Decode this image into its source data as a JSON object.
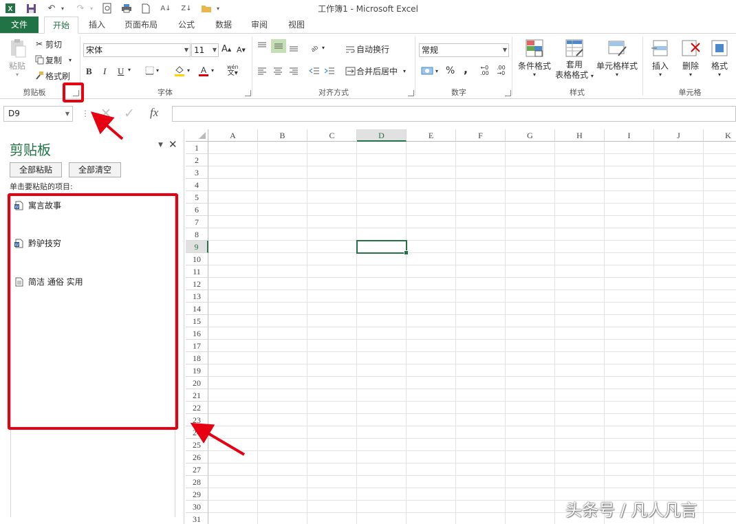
{
  "window": {
    "title": "工作簿1 - Microsoft Excel"
  },
  "tabs": [
    {
      "label": "文件"
    },
    {
      "label": "开始"
    },
    {
      "label": "插入"
    },
    {
      "label": "页面布局"
    },
    {
      "label": "公式"
    },
    {
      "label": "数据"
    },
    {
      "label": "审阅"
    },
    {
      "label": "视图"
    }
  ],
  "ribbon": {
    "clipboard": {
      "paste": "粘贴",
      "cut": "剪切",
      "copy": "复制",
      "format_painter": "格式刷",
      "group": "剪贴板"
    },
    "font": {
      "name": "宋体",
      "size": "11",
      "bold": "B",
      "italic": "I",
      "underline": "U",
      "phonetic": "wén",
      "group": "字体"
    },
    "alignment": {
      "wrap": "自动换行",
      "merge": "合并后居中",
      "group": "对齐方式"
    },
    "number": {
      "format": "常规",
      "percent": "%",
      "comma": ",",
      "group": "数字"
    },
    "styles": {
      "conditional": "条件格式",
      "table_l1": "套用",
      "table_l2": "表格格式",
      "cell_styles": "单元格样式",
      "group": "样式"
    },
    "cells": {
      "insert": "插入",
      "delete": "删除",
      "format": "格式",
      "group": "单元格"
    }
  },
  "formula_bar": {
    "name_box": "D9",
    "fx": "fx",
    "value": ""
  },
  "clipboard_pane": {
    "title": "剪贴板",
    "paste_all": "全部粘贴",
    "clear_all": "全部清空",
    "hint": "单击要粘贴的项目:",
    "items": [
      {
        "text": "寓言故事",
        "icon": "word-doc-icon"
      },
      {
        "text": "黔驴技穷",
        "icon": "word-doc-icon"
      },
      {
        "text": "简洁 通俗 实用",
        "icon": "text-doc-icon"
      }
    ]
  },
  "sheet": {
    "columns": [
      "A",
      "B",
      "C",
      "D",
      "E",
      "F",
      "G",
      "H",
      "I",
      "J",
      "K"
    ],
    "rows": [
      "1",
      "2",
      "3",
      "4",
      "5",
      "6",
      "7",
      "8",
      "9",
      "10",
      "11",
      "12",
      "13",
      "14",
      "15",
      "16",
      "17",
      "18",
      "19",
      "20",
      "21",
      "22",
      "23",
      "24",
      "25",
      "26",
      "27",
      "28",
      "29",
      "30",
      "31"
    ],
    "active_column": "D",
    "active_row": "9"
  },
  "colors": {
    "accent": "#217346",
    "annotation": "#e60012"
  },
  "watermark": "头条号 / 凡人凡言"
}
